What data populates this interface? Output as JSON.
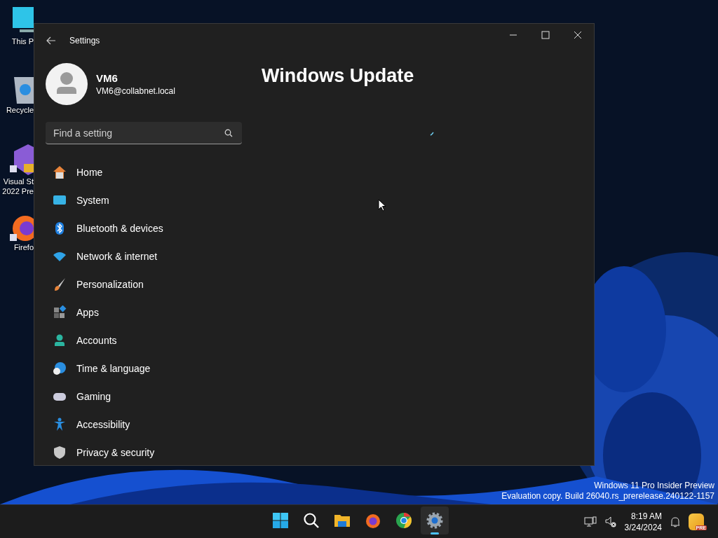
{
  "desktop_icons": [
    {
      "label": "This P"
    },
    {
      "label": "Recycle"
    },
    {
      "label": "Visual St 2022 Pre"
    },
    {
      "label": "Firefo"
    }
  ],
  "window": {
    "title": "Settings",
    "page_title": "Windows Update"
  },
  "profile": {
    "name": "VM6",
    "email": "VM6@collabnet.local"
  },
  "search": {
    "placeholder": "Find a setting"
  },
  "nav_items": [
    {
      "label": "Home",
      "selected": false
    },
    {
      "label": "System",
      "selected": false
    },
    {
      "label": "Bluetooth & devices",
      "selected": false
    },
    {
      "label": "Network & internet",
      "selected": false
    },
    {
      "label": "Personalization",
      "selected": false
    },
    {
      "label": "Apps",
      "selected": false
    },
    {
      "label": "Accounts",
      "selected": false
    },
    {
      "label": "Time & language",
      "selected": false
    },
    {
      "label": "Gaming",
      "selected": false
    },
    {
      "label": "Accessibility",
      "selected": false
    },
    {
      "label": "Privacy & security",
      "selected": false
    }
  ],
  "build_info": [
    "Windows 11 Pro Insider Preview",
    "Evaluation copy. Build 26040.rs_prerelease.240122-1157"
  ],
  "taskbar": {
    "apps": [
      {
        "selected": false
      },
      {
        "selected": false
      },
      {
        "selected": false
      },
      {
        "selected": false
      },
      {
        "selected": false
      },
      {
        "selected": true
      }
    ],
    "time": "8:19 AM",
    "date": "3/24/2024",
    "badge": "PRE"
  }
}
